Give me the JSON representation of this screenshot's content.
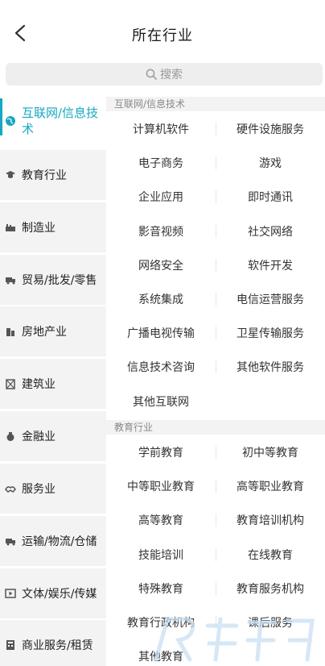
{
  "header": {
    "title": "所在行业"
  },
  "search": {
    "placeholder": "搜索"
  },
  "sidebar": {
    "items": [
      {
        "label": "互联网/信息技术",
        "icon": "globe-icon",
        "active": true
      },
      {
        "label": "教育行业",
        "icon": "graduation-cap-icon"
      },
      {
        "label": "制造业",
        "icon": "factory-icon"
      },
      {
        "label": "贸易/批发/零售",
        "icon": "truck-icon"
      },
      {
        "label": "房地产业",
        "icon": "building-icon"
      },
      {
        "label": "建筑业",
        "icon": "construction-icon"
      },
      {
        "label": "金融业",
        "icon": "money-bag-icon"
      },
      {
        "label": "服务业",
        "icon": "handshake-icon"
      },
      {
        "label": "运输/物流/仓储",
        "icon": "delivery-truck-icon"
      },
      {
        "label": "文体/娱乐/传媒",
        "icon": "media-player-icon"
      },
      {
        "label": "商业服务/租赁",
        "icon": "calculator-icon"
      }
    ]
  },
  "sections": [
    {
      "title": "互联网/信息技术",
      "items": [
        "计算机软件",
        "硬件设施服务",
        "电子商务",
        "游戏",
        "企业应用",
        "即时通讯",
        "影音视频",
        "社交网络",
        "网络安全",
        "软件开发",
        "系统集成",
        "电信运营服务",
        "广播电视传输",
        "卫星传输服务",
        "信息技术咨询",
        "其他软件服务",
        "其他互联网"
      ]
    },
    {
      "title": "教育行业",
      "items": [
        "学前教育",
        "初中等教育",
        "中等职业教育",
        "高等职业教育",
        "高等教育",
        "教育培训机构",
        "技能培训",
        "在线教育",
        "特殊教育",
        "教育服务机构",
        "教育行政机构",
        "课后服务",
        "其他教育"
      ]
    }
  ],
  "colors": {
    "accent": "#16a8c0",
    "sidebar_bg": "#f3f3f3",
    "section_bg": "#f3f3f3"
  }
}
